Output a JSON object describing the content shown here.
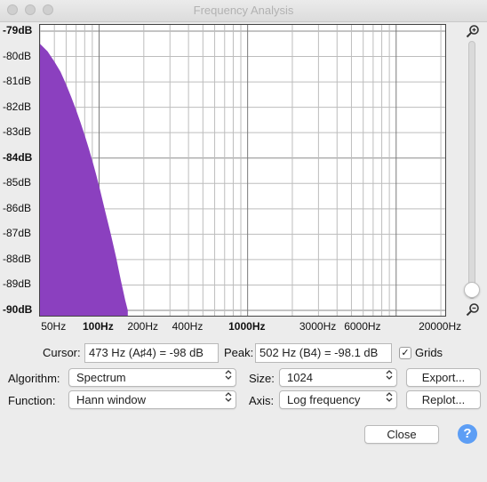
{
  "window": {
    "title": "Frequency Analysis"
  },
  "chart_data": {
    "type": "area",
    "x_scale": "log",
    "xlim": [
      40,
      22000
    ],
    "ylim": [
      -90,
      -79
    ],
    "grid": true,
    "color": "#8b40bf",
    "y_ticks": [
      {
        "label": "-79dB",
        "value": -79,
        "bold": true
      },
      {
        "label": "-80dB",
        "value": -80,
        "bold": false
      },
      {
        "label": "-81dB",
        "value": -81,
        "bold": false
      },
      {
        "label": "-82dB",
        "value": -82,
        "bold": false
      },
      {
        "label": "-83dB",
        "value": -83,
        "bold": false
      },
      {
        "label": "-84dB",
        "value": -84,
        "bold": true
      },
      {
        "label": "-85dB",
        "value": -85,
        "bold": false
      },
      {
        "label": "-86dB",
        "value": -86,
        "bold": false
      },
      {
        "label": "-87dB",
        "value": -87,
        "bold": false
      },
      {
        "label": "-88dB",
        "value": -88,
        "bold": false
      },
      {
        "label": "-89dB",
        "value": -89,
        "bold": false
      },
      {
        "label": "-90dB",
        "value": -90,
        "bold": true
      }
    ],
    "x_ticks": [
      {
        "label": "50Hz",
        "value": 50,
        "bold": false
      },
      {
        "label": "100Hz",
        "value": 100,
        "bold": true
      },
      {
        "label": "200Hz",
        "value": 200,
        "bold": false
      },
      {
        "label": "400Hz",
        "value": 400,
        "bold": false
      },
      {
        "label": "1000Hz",
        "value": 1000,
        "bold": true
      },
      {
        "label": "3000Hz",
        "value": 3000,
        "bold": false
      },
      {
        "label": "6000Hz",
        "value": 6000,
        "bold": false
      },
      {
        "label": "20000Hz",
        "value": 20000,
        "bold": false
      }
    ],
    "series": [
      {
        "x": [
          40,
          45,
          50,
          55,
          60,
          65,
          70,
          75,
          80,
          85,
          90,
          95,
          100,
          110,
          120,
          130,
          140,
          150,
          156
        ],
        "y": [
          -79.5,
          -79.8,
          -80.2,
          -80.6,
          -81.1,
          -81.6,
          -82.1,
          -82.6,
          -83.1,
          -83.6,
          -84.1,
          -84.6,
          -85.1,
          -86.1,
          -87.0,
          -87.9,
          -88.8,
          -89.6,
          -90.0
        ]
      }
    ]
  },
  "readouts": {
    "cursor_label": "Cursor:",
    "cursor_value": "473 Hz (A♯4) = -98 dB",
    "peak_label": "Peak:",
    "peak_value": "502 Hz (B4) = -98.1 dB",
    "grids_label": "Grids",
    "grids_checked": true
  },
  "controls": {
    "algorithm_label": "Algorithm:",
    "algorithm_value": "Spectrum",
    "size_label": "Size:",
    "size_value": "1024",
    "function_label": "Function:",
    "function_value": "Hann window",
    "axis_label": "Axis:",
    "axis_value": "Log frequency",
    "export_label": "Export...",
    "replot_label": "Replot...",
    "close_label": "Close",
    "help_label": "?"
  },
  "icons": {
    "zoom_in": "zoom-in-icon",
    "zoom_out": "zoom-out-icon",
    "select_arrows": "⌃⌄",
    "check": "✓"
  }
}
